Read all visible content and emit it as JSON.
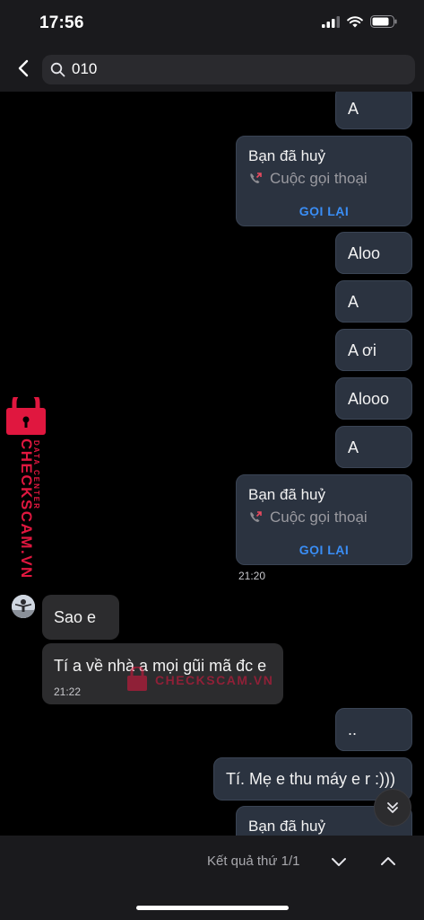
{
  "status_bar": {
    "time": "17:56"
  },
  "search": {
    "query": "010"
  },
  "messages": {
    "m1": "A",
    "call1": {
      "title": "Bạn đã huỷ",
      "subtitle": "Cuộc gọi thoại",
      "action": "GỌI LẠI"
    },
    "m2": "Aloo",
    "m3": "A",
    "m4": "A ơi",
    "m5": "Alooo",
    "m6": "A",
    "call2": {
      "title": "Bạn đã huỷ",
      "subtitle": "Cuộc gọi thoại",
      "action": "GỌI LẠI"
    },
    "time1": "21:20",
    "in1": "Sao e",
    "in2": "Tí a về nhà a mọi gũi mã đc e",
    "time2": "21:22",
    "m7": "..",
    "m8": "Tí. Mẹ e thu máy e r :)))",
    "call3_title": "Bạn đã huỷ"
  },
  "watermark": {
    "side_text": "CHECKSCAM.VN",
    "side_sub": "DATA CENTER",
    "mid_text": "CHECKSCAM.VN",
    "color": "#e0173f"
  },
  "footer": {
    "result": "Kết quả thứ 1/1"
  },
  "colors": {
    "accent": "#3a8ef6",
    "outgoing_bubble": "#2b3340",
    "incoming_bubble": "#2c2c2e"
  }
}
